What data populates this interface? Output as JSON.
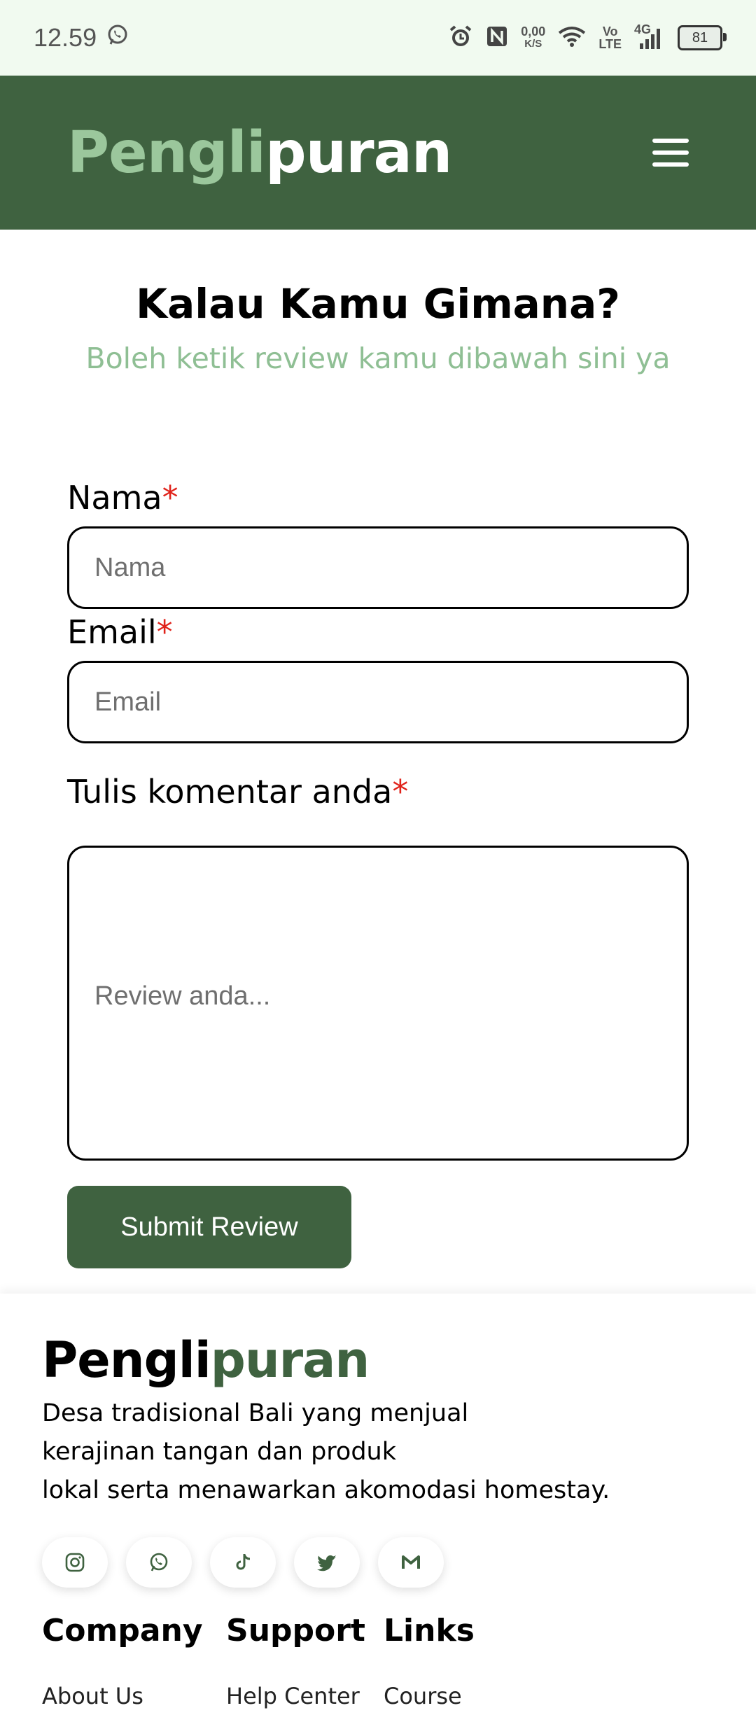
{
  "status_bar": {
    "time": "12.59",
    "net_speed_value": "0,00",
    "net_speed_unit": "K/S",
    "volte_top": "Vo",
    "volte_bottom": "LTE",
    "network": "4G",
    "battery": "81"
  },
  "header": {
    "logo_part1": "Pengli",
    "logo_part2": "puran",
    "icons": {
      "menu": "hamburger-menu-icon"
    }
  },
  "form": {
    "title": "Kalau Kamu Gimana?",
    "subtitle": "Boleh ketik review kamu dibawah sini ya",
    "name_label": "Nama",
    "name_placeholder": "Nama",
    "email_label": "Email",
    "email_placeholder": "Email",
    "comment_label": "Tulis komentar anda",
    "comment_placeholder": "Review anda...",
    "required_mark": "*",
    "submit_label": "Submit Review"
  },
  "footer": {
    "logo_part1": "Pengli",
    "logo_part2": "puran",
    "description_lines": [
      "Desa tradisional Bali yang menjual",
      "kerajinan tangan dan produk",
      "lokal serta menawarkan akomodasi homestay."
    ],
    "socials": [
      "instagram-icon",
      "whatsapp-icon",
      "tiktok-icon",
      "twitter-icon",
      "gmail-icon"
    ],
    "columns": [
      {
        "heading": "Company",
        "first_link": "About Us"
      },
      {
        "heading": "Support",
        "first_link": "Help Center"
      },
      {
        "heading": "Links",
        "first_link": "Course"
      }
    ]
  },
  "colors": {
    "brand_green": "#3f6240",
    "light_green": "#9bc79c",
    "subtitle_green": "#8fbf94",
    "required_red": "#e0221a"
  }
}
